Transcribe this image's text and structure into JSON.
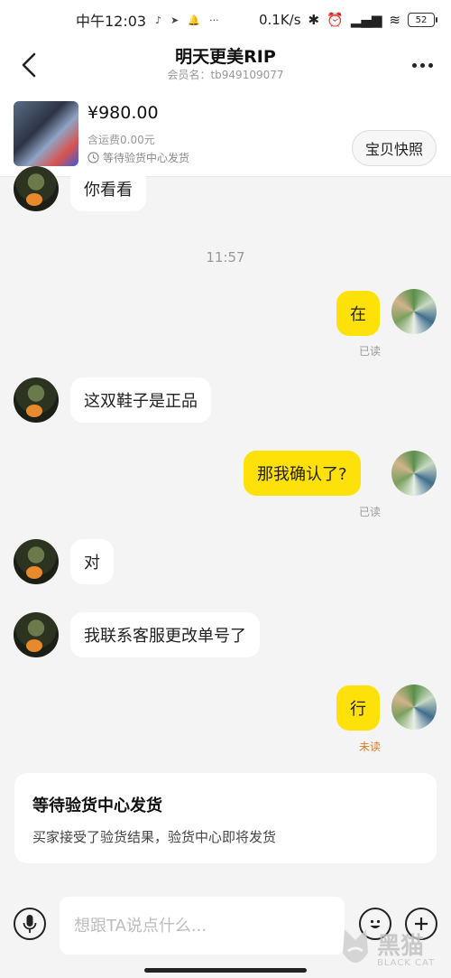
{
  "status_bar": {
    "time": "中午12:03",
    "network_speed": "0.1K/s",
    "battery": "52",
    "icons": [
      "tiktok-icon",
      "send-icon",
      "bell-icon",
      "more-dots-icon",
      "bluetooth-icon",
      "alarm-icon",
      "signal-icon",
      "wifi-icon",
      "battery-icon"
    ]
  },
  "header": {
    "title": "明天更美RIP",
    "member": "会员名：tb949109077"
  },
  "product": {
    "price": "¥980.00",
    "shipping": "含运费0.00元",
    "status": "等待验货中心发货",
    "snapshot_label": "宝贝快照"
  },
  "messages": {
    "m1": "你看看",
    "time1": "11:57",
    "m2": "在",
    "m2_read": "已读",
    "m3": "这双鞋子是正品",
    "m4": "那我确认了?",
    "m4_read": "已读",
    "m5": "对",
    "m6": "我联系客服更改单号了",
    "m7": "行",
    "m7_read": "未读"
  },
  "status_card": {
    "title": "等待验货中心发货",
    "desc": "买家接受了验货结果，验货中心即将发货"
  },
  "input": {
    "placeholder": "想跟TA说点什么..."
  },
  "watermark": {
    "main": "黑猫",
    "sub": "BLACK CAT"
  },
  "colors": {
    "bubble_self": "#ffe10a",
    "bubble_other": "#ffffff",
    "unread": "#e07b2b",
    "background": "#f4f4f4"
  }
}
